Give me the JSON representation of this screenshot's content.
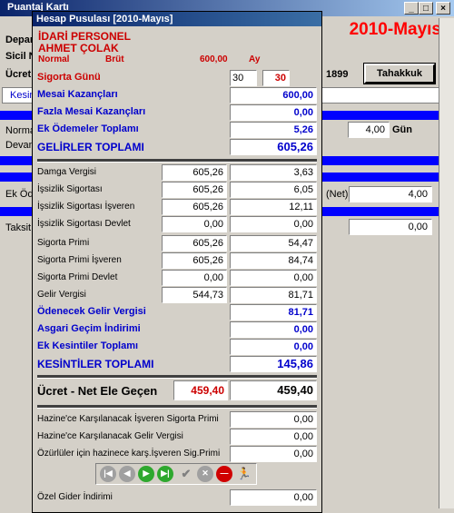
{
  "background": {
    "title": "Puantaj Kartı",
    "period_big": "2010-Mayıs",
    "labels": {
      "depa": "Depar",
      "sicil": "Sicil N",
      "ucret": "Ücret",
      "kesin": "Kesin",
      "normal": "Norma",
      "devam": "Devam",
      "ek_odeme": "Ek Öde",
      "taksit": "Taksit",
      "net": "(Net)",
      "gun": "Gün",
      "code": "1899"
    },
    "tahakkuk_label": "Tahakkuk",
    "fields": {
      "normal_value": "4,00",
      "net_value": "4,00",
      "taksit_value": "0,00"
    }
  },
  "dialog": {
    "title": "Hesap Pusulası   [2010-Mayıs]",
    "dept": "İDARİ PERSONEL",
    "name": "AHMET ÇOLAK",
    "sub": {
      "normal": "Normal",
      "brut": "Brüt",
      "amount": "600,00",
      "ay": "Ay"
    },
    "sigorta_gunu": {
      "label": "Sigorta Günü",
      "value1": "30",
      "value2": "30"
    },
    "income": [
      {
        "label": "Mesai Kazançları",
        "value": "600,00"
      },
      {
        "label": "Fazla Mesai Kazançları",
        "value": "0,00"
      },
      {
        "label": "Ek Ödemeler Toplamı",
        "value": "5,26"
      },
      {
        "label": "GELİRLER TOPLAMI",
        "value": "605,26"
      }
    ],
    "deductions": [
      {
        "label": "Damga Vergisi",
        "base": "605,26",
        "value": "3,63"
      },
      {
        "label": "İşsizlik Sigortası",
        "base": "605,26",
        "value": "6,05"
      },
      {
        "label": "İşsizlik Sigortası İşveren",
        "base": "605,26",
        "value": "12,11"
      },
      {
        "label": "İşsizlik Sigortası Devlet",
        "base": "0,00",
        "value": "0,00"
      },
      {
        "label": "Sigorta Primi",
        "base": "605,26",
        "value": "54,47"
      },
      {
        "label": "Sigorta Primi İşveren",
        "base": "605,26",
        "value": "84,74"
      },
      {
        "label": "Sigorta Primi Devlet",
        "base": "0,00",
        "value": "0,00"
      },
      {
        "label": "Gelir Vergisi",
        "base": "544,73",
        "value": "81,71"
      }
    ],
    "tax_summary": [
      {
        "label": "Ödenecek Gelir Vergisi",
        "value": "81,71"
      },
      {
        "label": "Asgari Geçim İndirimi",
        "value": "0,00"
      },
      {
        "label": "Ek Kesintiler Toplamı",
        "value": "0,00"
      },
      {
        "label": "KESİNTİLER TOPLAMI",
        "value": "145,86"
      }
    ],
    "net": {
      "label": "Ücret - Net Ele Geçen",
      "value_red": "459,40",
      "value": "459,40"
    },
    "treasury": [
      {
        "label": "Hazine'ce Karşılanacak İşveren Sigorta Primi",
        "value": "0,00"
      },
      {
        "label": "Hazine'ce Karşılanacak Gelir Vergisi",
        "value": "0,00"
      },
      {
        "label": "Özürlüler için hazinece karş.İşveren Sig.Primi",
        "value": "0,00"
      }
    ],
    "ozel_gider": {
      "label": "Özel Gider İndirimi",
      "value": "0,00"
    }
  }
}
